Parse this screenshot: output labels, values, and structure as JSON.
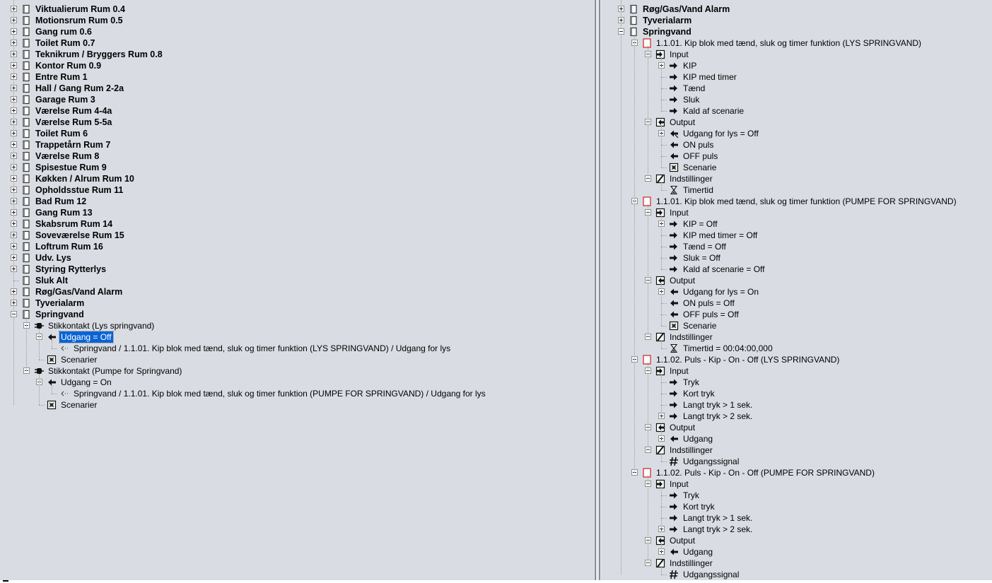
{
  "left_tree": [
    {
      "label": "Viktualierum Rum 0.4",
      "level": 0,
      "icon": "room-icon",
      "exp": "plus",
      "bold": true
    },
    {
      "label": "Motionsrum Rum 0.5",
      "level": 0,
      "icon": "room-icon",
      "exp": "plus",
      "bold": true
    },
    {
      "label": "Gang rum 0.6",
      "level": 0,
      "icon": "room-icon",
      "exp": "plus",
      "bold": true
    },
    {
      "label": "Toilet Rum 0.7",
      "level": 0,
      "icon": "room-icon",
      "exp": "plus",
      "bold": true
    },
    {
      "label": "Teknikrum / Bryggers Rum 0.8",
      "level": 0,
      "icon": "room-icon",
      "exp": "plus",
      "bold": true
    },
    {
      "label": "Kontor Rum 0.9",
      "level": 0,
      "icon": "room-icon",
      "exp": "plus",
      "bold": true
    },
    {
      "label": "Entre Rum 1",
      "level": 0,
      "icon": "room-icon",
      "exp": "plus",
      "bold": true
    },
    {
      "label": "Hall / Gang Rum 2-2a",
      "level": 0,
      "icon": "room-icon",
      "exp": "plus",
      "bold": true
    },
    {
      "label": "Garage Rum 3",
      "level": 0,
      "icon": "room-icon",
      "exp": "plus",
      "bold": true
    },
    {
      "label": "Værelse Rum 4-4a",
      "level": 0,
      "icon": "room-icon",
      "exp": "plus",
      "bold": true
    },
    {
      "label": "Værelse Rum 5-5a",
      "level": 0,
      "icon": "room-icon",
      "exp": "plus",
      "bold": true
    },
    {
      "label": "Toilet Rum 6",
      "level": 0,
      "icon": "room-icon",
      "exp": "plus",
      "bold": true
    },
    {
      "label": "Trappetårn Rum 7",
      "level": 0,
      "icon": "room-icon",
      "exp": "plus",
      "bold": true
    },
    {
      "label": "Værelse Rum 8",
      "level": 0,
      "icon": "room-icon",
      "exp": "plus",
      "bold": true
    },
    {
      "label": "Spisestue Rum 9",
      "level": 0,
      "icon": "room-icon",
      "exp": "plus",
      "bold": true
    },
    {
      "label": "Køkken / Alrum Rum 10",
      "level": 0,
      "icon": "room-icon",
      "exp": "plus",
      "bold": true
    },
    {
      "label": "Opholdsstue Rum 11",
      "level": 0,
      "icon": "room-icon",
      "exp": "plus",
      "bold": true
    },
    {
      "label": "Bad Rum 12",
      "level": 0,
      "icon": "room-icon",
      "exp": "plus",
      "bold": true
    },
    {
      "label": "Gang Rum 13",
      "level": 0,
      "icon": "room-icon",
      "exp": "plus",
      "bold": true
    },
    {
      "label": "Skabsrum Rum 14",
      "level": 0,
      "icon": "room-icon",
      "exp": "plus",
      "bold": true
    },
    {
      "label": "Soveværelse Rum 15",
      "level": 0,
      "icon": "room-icon",
      "exp": "plus",
      "bold": true
    },
    {
      "label": "Loftrum Rum 16",
      "level": 0,
      "icon": "room-icon",
      "exp": "plus",
      "bold": true
    },
    {
      "label": "Udv. Lys",
      "level": 0,
      "icon": "room-icon",
      "exp": "plus",
      "bold": true
    },
    {
      "label": "Styring Rytterlys",
      "level": 0,
      "icon": "room-icon",
      "exp": "plus",
      "bold": true
    },
    {
      "label": "Sluk Alt",
      "level": 0,
      "icon": "room-icon",
      "exp": "none",
      "bold": true
    },
    {
      "label": "Røg/Gas/Vand Alarm",
      "level": 0,
      "icon": "room-icon",
      "exp": "plus",
      "bold": true
    },
    {
      "label": "Tyverialarm",
      "level": 0,
      "icon": "room-icon",
      "exp": "plus",
      "bold": true
    },
    {
      "label": "Springvand",
      "level": 0,
      "icon": "room-icon",
      "exp": "minus",
      "bold": true
    },
    {
      "label": "Stikkontakt (Lys springvand)",
      "level": 1,
      "icon": "plug-icon",
      "exp": "minus",
      "bold": false
    },
    {
      "label": "Udgang = Off",
      "level": 2,
      "icon": "output-arrow-icon",
      "exp": "minus",
      "bold": false,
      "selected": true
    },
    {
      "label": "Springvand / 1.1.01. Kip blok med tænd, sluk og timer funktion (LYS SPRINGVAND) / Udgang for lys",
      "level": 3,
      "icon": "link-arrow-icon",
      "exp": "none",
      "bold": false
    },
    {
      "label": "Scenarier",
      "level": 2,
      "icon": "scene-icon",
      "exp": "none",
      "bold": false
    },
    {
      "label": "Stikkontakt (Pumpe for Springvand)",
      "level": 1,
      "icon": "plug-icon",
      "exp": "minus",
      "bold": false
    },
    {
      "label": "Udgang = On",
      "level": 2,
      "icon": "output-arrow-icon",
      "exp": "minus",
      "bold": false
    },
    {
      "label": "Springvand / 1.1.01. Kip blok med tænd, sluk og timer funktion (PUMPE FOR SPRINGVAND) / Udgang for lys",
      "level": 3,
      "icon": "link-arrow-icon",
      "exp": "none",
      "bold": false
    },
    {
      "label": "Scenarier",
      "level": 2,
      "icon": "scene-icon",
      "exp": "none",
      "bold": false
    }
  ],
  "right_tree": [
    {
      "label": "Røg/Gas/Vand Alarm",
      "level": 0,
      "icon": "room-icon",
      "exp": "plus",
      "bold": true
    },
    {
      "label": "Tyverialarm",
      "level": 0,
      "icon": "room-icon",
      "exp": "plus",
      "bold": true
    },
    {
      "label": "Springvand",
      "level": 0,
      "icon": "room-icon",
      "exp": "minus",
      "bold": true
    },
    {
      "label": "1.1.01. Kip blok med tænd, sluk og timer funktion (LYS SPRINGVAND)",
      "level": 1,
      "icon": "block-icon",
      "exp": "minus",
      "bold": false
    },
    {
      "label": "Input",
      "level": 2,
      "icon": "input-icon",
      "exp": "minus",
      "bold": false
    },
    {
      "label": "KIP",
      "level": 3,
      "icon": "input-arrow-icon",
      "exp": "plus",
      "bold": false
    },
    {
      "label": "KIP med timer",
      "level": 3,
      "icon": "input-arrow-icon",
      "exp": "none",
      "bold": false
    },
    {
      "label": "Tænd",
      "level": 3,
      "icon": "input-arrow-icon",
      "exp": "none",
      "bold": false
    },
    {
      "label": "Sluk",
      "level": 3,
      "icon": "input-arrow-icon",
      "exp": "none",
      "bold": false
    },
    {
      "label": "Kald af scenarie",
      "level": 3,
      "icon": "input-arrow-icon",
      "exp": "none",
      "bold": false
    },
    {
      "label": "Output",
      "level": 2,
      "icon": "output-icon",
      "exp": "minus",
      "bold": false
    },
    {
      "label": "Udgang for lys = Off",
      "level": 3,
      "icon": "linked-output-arrow-icon",
      "exp": "plus",
      "bold": false
    },
    {
      "label": "ON puls",
      "level": 3,
      "icon": "output-arrow-icon",
      "exp": "none",
      "bold": false
    },
    {
      "label": "OFF puls",
      "level": 3,
      "icon": "output-arrow-icon",
      "exp": "none",
      "bold": false
    },
    {
      "label": "Scenarie",
      "level": 3,
      "icon": "scene-icon",
      "exp": "none",
      "bold": false
    },
    {
      "label": "Indstillinger",
      "level": 2,
      "icon": "settings-icon",
      "exp": "minus",
      "bold": false
    },
    {
      "label": "Timertid",
      "level": 3,
      "icon": "hourglass-icon",
      "exp": "none",
      "bold": false
    },
    {
      "label": "1.1.01. Kip blok med tænd, sluk og timer funktion (PUMPE FOR SPRINGVAND)",
      "level": 1,
      "icon": "block-icon",
      "exp": "minus",
      "bold": false
    },
    {
      "label": "Input",
      "level": 2,
      "icon": "input-icon",
      "exp": "minus",
      "bold": false
    },
    {
      "label": "KIP = Off",
      "level": 3,
      "icon": "input-arrow-icon",
      "exp": "plus",
      "bold": false
    },
    {
      "label": "KIP med timer = Off",
      "level": 3,
      "icon": "input-arrow-icon",
      "exp": "none",
      "bold": false
    },
    {
      "label": "Tænd = Off",
      "level": 3,
      "icon": "input-arrow-icon",
      "exp": "none",
      "bold": false
    },
    {
      "label": "Sluk = Off",
      "level": 3,
      "icon": "input-arrow-icon",
      "exp": "none",
      "bold": false
    },
    {
      "label": "Kald af scenarie = Off",
      "level": 3,
      "icon": "input-arrow-icon",
      "exp": "none",
      "bold": false
    },
    {
      "label": "Output",
      "level": 2,
      "icon": "output-icon",
      "exp": "minus",
      "bold": false
    },
    {
      "label": "Udgang for lys = On",
      "level": 3,
      "icon": "output-arrow-icon",
      "exp": "plus",
      "bold": false
    },
    {
      "label": "ON puls = Off",
      "level": 3,
      "icon": "output-arrow-icon",
      "exp": "none",
      "bold": false
    },
    {
      "label": "OFF puls = Off",
      "level": 3,
      "icon": "output-arrow-icon",
      "exp": "none",
      "bold": false
    },
    {
      "label": "Scenarie",
      "level": 3,
      "icon": "scene-icon",
      "exp": "none",
      "bold": false
    },
    {
      "label": "Indstillinger",
      "level": 2,
      "icon": "settings-icon",
      "exp": "minus",
      "bold": false
    },
    {
      "label": "Timertid = 00:04:00,000",
      "level": 3,
      "icon": "hourglass-icon",
      "exp": "none",
      "bold": false
    },
    {
      "label": "1.1.02. Puls - Kip - On - Off (LYS SPRINGVAND)",
      "level": 1,
      "icon": "block-icon",
      "exp": "minus",
      "bold": false
    },
    {
      "label": "Input",
      "level": 2,
      "icon": "input-icon",
      "exp": "minus",
      "bold": false
    },
    {
      "label": "Tryk",
      "level": 3,
      "icon": "input-arrow-icon",
      "exp": "none",
      "bold": false
    },
    {
      "label": "Kort tryk",
      "level": 3,
      "icon": "input-arrow-icon",
      "exp": "none",
      "bold": false
    },
    {
      "label": "Langt tryk > 1 sek.",
      "level": 3,
      "icon": "input-arrow-icon",
      "exp": "none",
      "bold": false
    },
    {
      "label": "Langt tryk > 2 sek.",
      "level": 3,
      "icon": "input-arrow-icon",
      "exp": "plus",
      "bold": false
    },
    {
      "label": "Output",
      "level": 2,
      "icon": "output-icon",
      "exp": "minus",
      "bold": false
    },
    {
      "label": "Udgang",
      "level": 3,
      "icon": "output-arrow-icon",
      "exp": "plus",
      "bold": false
    },
    {
      "label": "Indstillinger",
      "level": 2,
      "icon": "settings-icon",
      "exp": "minus",
      "bold": false
    },
    {
      "label": "Udgangssignal",
      "level": 3,
      "icon": "hash-icon",
      "exp": "none",
      "bold": false
    },
    {
      "label": "1.1.02. Puls - Kip - On - Off (PUMPE FOR SPRINGVAND)",
      "level": 1,
      "icon": "block-icon",
      "exp": "minus",
      "bold": false
    },
    {
      "label": "Input",
      "level": 2,
      "icon": "input-icon",
      "exp": "minus",
      "bold": false
    },
    {
      "label": "Tryk",
      "level": 3,
      "icon": "input-arrow-icon",
      "exp": "none",
      "bold": false
    },
    {
      "label": "Kort tryk",
      "level": 3,
      "icon": "input-arrow-icon",
      "exp": "none",
      "bold": false
    },
    {
      "label": "Langt tryk > 1 sek.",
      "level": 3,
      "icon": "input-arrow-icon",
      "exp": "none",
      "bold": false
    },
    {
      "label": "Langt tryk > 2 sek.",
      "level": 3,
      "icon": "input-arrow-icon",
      "exp": "plus",
      "bold": false
    },
    {
      "label": "Output",
      "level": 2,
      "icon": "output-icon",
      "exp": "minus",
      "bold": false
    },
    {
      "label": "Udgang",
      "level": 3,
      "icon": "output-arrow-icon",
      "exp": "plus",
      "bold": false
    },
    {
      "label": "Indstillinger",
      "level": 2,
      "icon": "settings-icon",
      "exp": "minus",
      "bold": false
    },
    {
      "label": "Udgangssignal",
      "level": 3,
      "icon": "hash-icon",
      "exp": "none",
      "bold": false
    }
  ],
  "colors": {
    "background": "#d9dde3",
    "selection": "#0a64d4",
    "block_icon": "#cc2222"
  }
}
